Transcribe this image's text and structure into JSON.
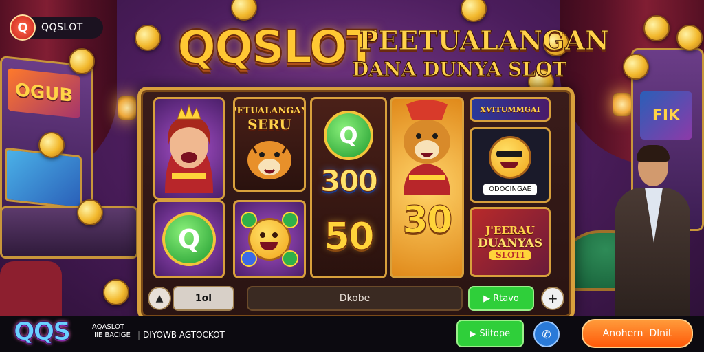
{
  "brand": {
    "icon_letter": "Q",
    "name": "QQSLOT"
  },
  "title": {
    "main": "QQSLOT",
    "line1": "PEETUALANGAN",
    "line2": "DANA DUNYA SLOT"
  },
  "reels": {
    "r1_label": "",
    "r2_top_label_1": "PETUALANGAN",
    "r2_top_label_2": "SERU",
    "r3_top_value": "300",
    "r3_bottom_value": "50",
    "r4_bottom_value": "30",
    "r5_header": "XVITUMMGAI",
    "r5_caption": "ODOCINGAE",
    "r5_bottom_1": "J'EERAU",
    "r5_bottom_2": "DUANYAS",
    "r5_bottom_3": "SLOTI"
  },
  "controls": {
    "bet_label": "1ol",
    "center_label": "Dkobe",
    "spin_label": "Rtavo",
    "plus_label": "+"
  },
  "bottom_bar": {
    "logo": "QQS",
    "tag_1": "AQASLOT",
    "tag_2": "IIIE BACIGE",
    "slogan": "DIYOWB AGTOCKOT",
    "green_btn": "Siitope",
    "orange_btn": "Anohern  Dlnit"
  },
  "colors": {
    "gold": "#d8a03c",
    "green": "#2fcf3a",
    "orange": "#ff7a1a"
  },
  "icons": [
    "q-logo-icon",
    "hammer-icon",
    "plus-icon",
    "play-icon",
    "phone-icon",
    "coin-icon"
  ]
}
